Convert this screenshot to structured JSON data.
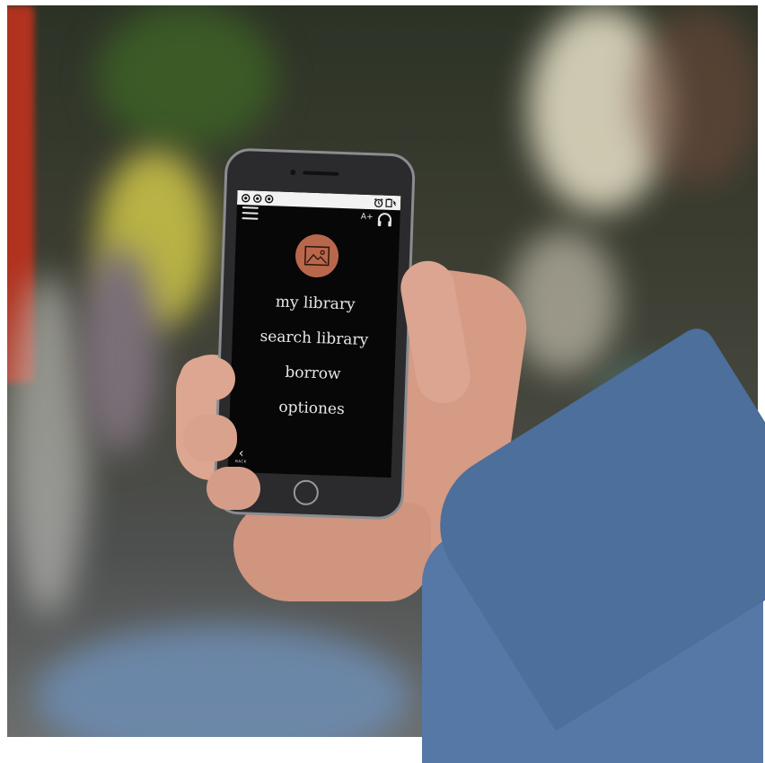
{
  "status_bar": {
    "right_icons": [
      "alarm-icon",
      "battery-icon"
    ],
    "left_icons": [
      "notification-circle-icon"
    ]
  },
  "toolbar": {
    "font_size_label": "A+"
  },
  "menu": {
    "items": [
      {
        "label": "my library"
      },
      {
        "label": "search library"
      },
      {
        "label": "borrow"
      },
      {
        "label": "optiones"
      }
    ]
  },
  "footer": {
    "back_label": "BACK"
  },
  "colors": {
    "screen_bg": "#070707",
    "avatar_accent": "#b9674b",
    "text": "#e8e8e8",
    "status_bar_bg": "#f2f2f2"
  }
}
